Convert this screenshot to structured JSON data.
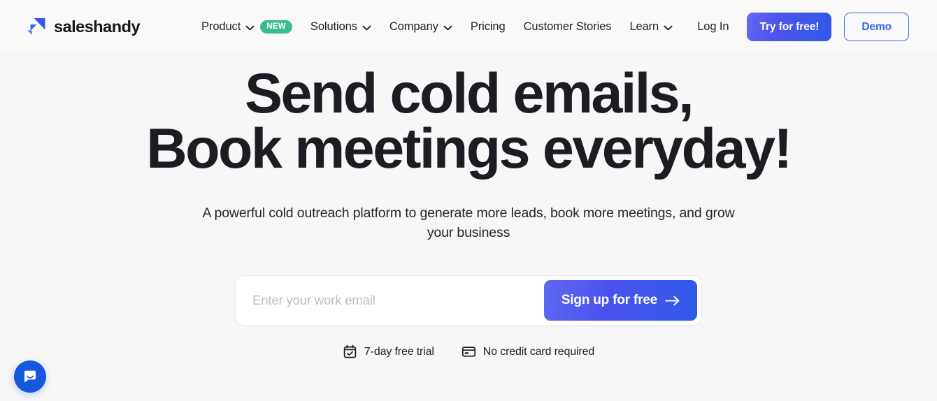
{
  "brand": {
    "name": "saleshandy",
    "logo_icon": "saleshandy-arrow-logo",
    "accent_blue": "#2f5ae8",
    "accent_indigo": "#6168f0",
    "badge_green": "#39bb8e"
  },
  "nav": {
    "items": [
      {
        "label": "Product",
        "has_dropdown": true,
        "badge": "NEW"
      },
      {
        "label": "Solutions",
        "has_dropdown": true,
        "badge": null
      },
      {
        "label": "Company",
        "has_dropdown": true,
        "badge": null
      },
      {
        "label": "Pricing",
        "has_dropdown": false,
        "badge": null
      },
      {
        "label": "Customer Stories",
        "has_dropdown": false,
        "badge": null
      },
      {
        "label": "Learn",
        "has_dropdown": true,
        "badge": null
      }
    ],
    "login_label": "Log In",
    "try_label": "Try for free!",
    "demo_label": "Demo"
  },
  "hero": {
    "headline_line1": "Send cold emails,",
    "headline_line2": "Book meetings everyday!",
    "subheadline": "A powerful cold outreach platform to generate more leads, book more meetings, and grow your business"
  },
  "signup": {
    "email_value": "",
    "email_placeholder": "Enter your work email",
    "submit_label": "Sign up for free",
    "submit_icon": "arrow-right-icon"
  },
  "trust": [
    {
      "icon": "calendar-check-icon",
      "label": "7-day free trial"
    },
    {
      "icon": "credit-card-icon",
      "label": "No credit card required"
    }
  ],
  "chat": {
    "icon": "intercom-chat-icon",
    "color": "#1657e0"
  }
}
